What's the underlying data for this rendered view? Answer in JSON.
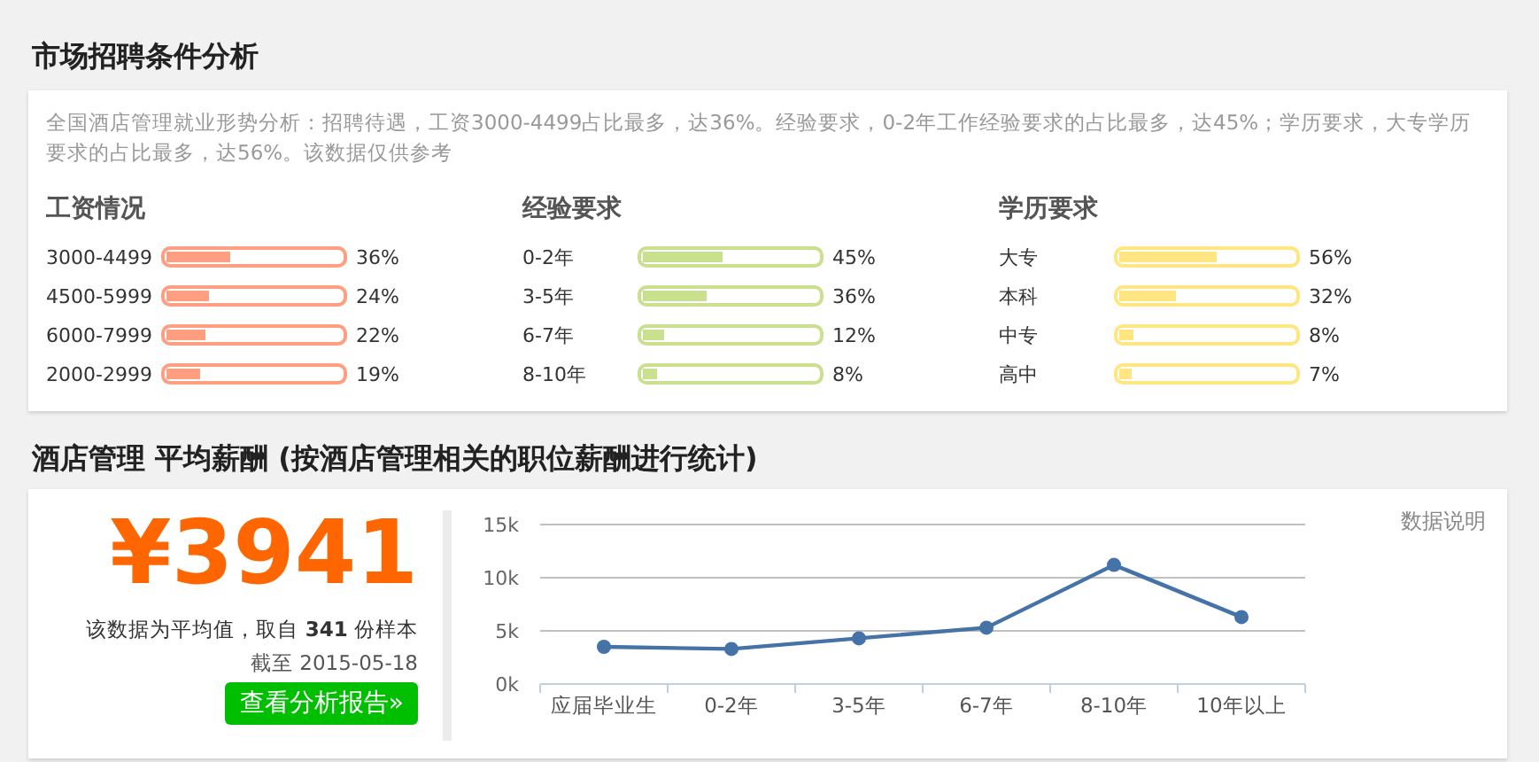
{
  "market": {
    "title": "市场招聘条件分析",
    "summary": "全国酒店管理就业形势分析：招聘待遇，工资3000-4499占比最多，达36%。经验要求，0-2年工作经验要求的占比最多，达45%；学历要求，大专学历要求的占比最多，达56%。该数据仅供参考",
    "groups": [
      {
        "title": "工资情况",
        "color": "#ff9e80",
        "rows": [
          {
            "label": "3000-4499",
            "level": 0.36,
            "reading": "36%"
          },
          {
            "label": "4500-5999",
            "level": 0.24,
            "reading": "24%"
          },
          {
            "label": "6000-7999",
            "level": 0.22,
            "reading": "22%"
          },
          {
            "label": "2000-2999",
            "level": 0.19,
            "reading": "19%"
          }
        ]
      },
      {
        "title": "经验要求",
        "color": "#c9e08f",
        "rows": [
          {
            "label": "0-2年",
            "level": 0.45,
            "reading": "45%"
          },
          {
            "label": "3-5年",
            "level": 0.36,
            "reading": "36%"
          },
          {
            "label": "6-7年",
            "level": 0.12,
            "reading": "12%"
          },
          {
            "label": "8-10年",
            "level": 0.08,
            "reading": "8%"
          }
        ]
      },
      {
        "title": "学历要求",
        "color": "#ffe680",
        "rows": [
          {
            "label": "大专",
            "level": 0.56,
            "reading": "56%"
          },
          {
            "label": "本科",
            "level": 0.32,
            "reading": "32%"
          },
          {
            "label": "中专",
            "level": 0.08,
            "reading": "8%"
          },
          {
            "label": "高中",
            "level": 0.07,
            "reading": "7%"
          }
        ]
      }
    ]
  },
  "salary": {
    "title": "酒店管理 平均薪酬 (按酒店管理相关的职位薪酬进行统计)",
    "amount": "¥3941",
    "note": "该数据为平均值，取自 **341** 份样本",
    "date_label": "截至",
    "date": "2015-05-18",
    "report_button": "查看分析报告»",
    "data_note": "数据说明",
    "chart_data": {
      "type": "line",
      "categories": [
        "应届毕业生",
        "0-2年",
        "3-5年",
        "6-7年",
        "8-10年",
        "10年以上"
      ],
      "yticks": [
        {
          "value": 0,
          "label": "0k"
        },
        {
          "value": 5000,
          "label": "5k"
        },
        {
          "value": 10000,
          "label": "10k"
        },
        {
          "value": 15000,
          "label": "15k"
        }
      ],
      "ylim": [
        0,
        15000
      ],
      "series": [
        {
          "color": "#4572a7",
          "marker": "circle",
          "values": [
            3500,
            3300,
            4300,
            5300,
            11200,
            6300
          ]
        }
      ]
    }
  }
}
